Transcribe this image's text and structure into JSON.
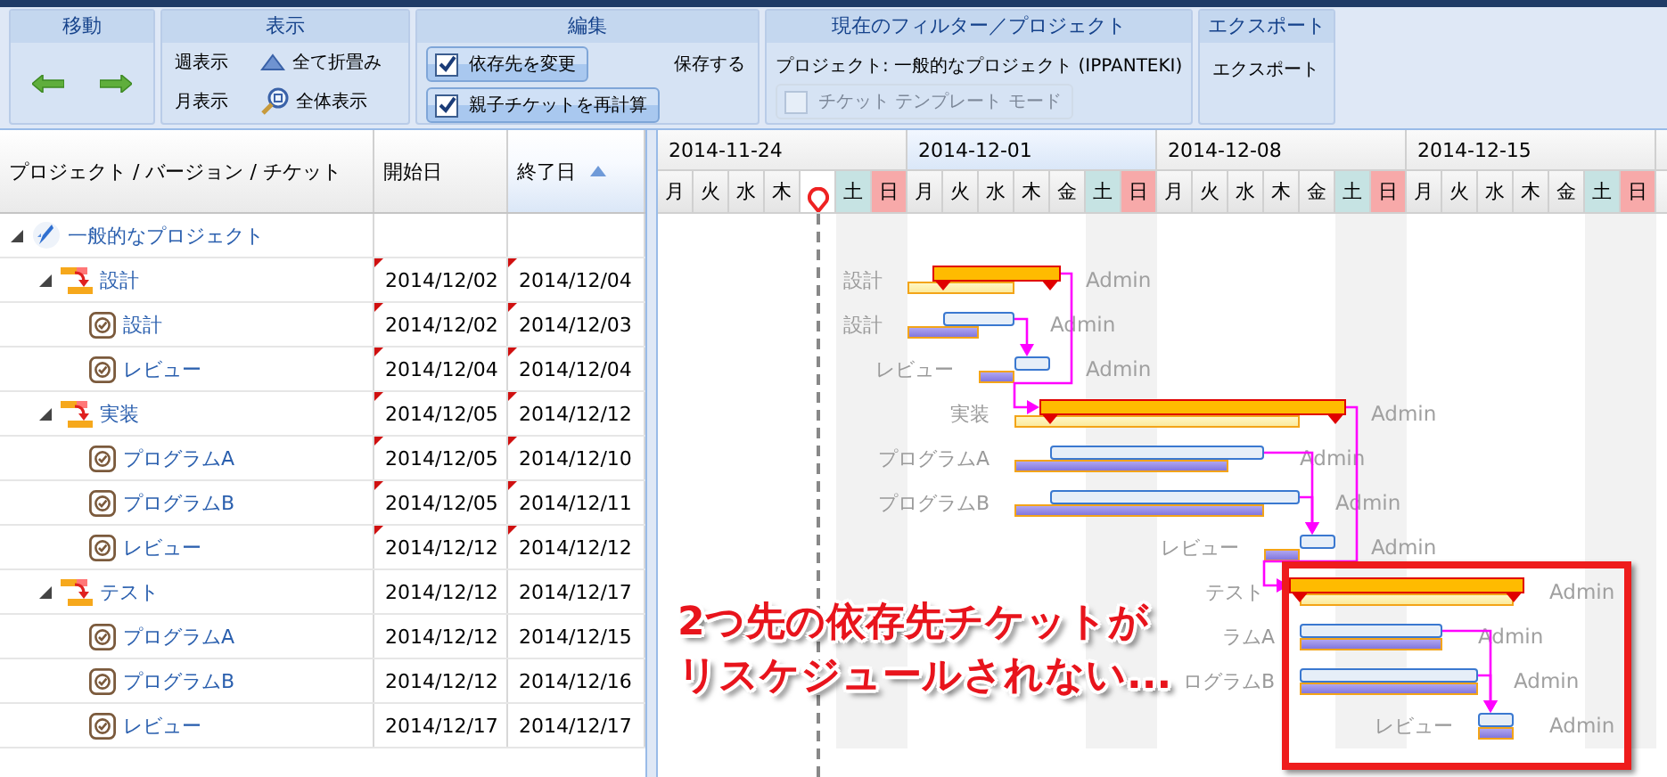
{
  "toolbar": {
    "groups": [
      {
        "kind": "move",
        "title": "移動",
        "items": [
          {
            "kind": "arrow_left"
          },
          {
            "kind": "arrow_right"
          }
        ]
      },
      {
        "kind": "view",
        "title": "表示",
        "items": [
          {
            "kind": "text",
            "label": "週表示"
          },
          {
            "kind": "collapse",
            "label": "全て折畳み"
          },
          {
            "kind": "text",
            "label": "月表示"
          },
          {
            "kind": "zoom",
            "label": "全体表示"
          }
        ]
      },
      {
        "kind": "edit",
        "title": "編集",
        "items": [
          {
            "kind": "check",
            "label": "依存先を変更",
            "checked": true,
            "disabled": false
          },
          {
            "kind": "text",
            "label": "保存する"
          },
          {
            "kind": "check",
            "label": "親子チケットを再計算",
            "checked": true,
            "disabled": false
          }
        ]
      },
      {
        "kind": "filter",
        "title": "現在のフィルター／プロジェクト",
        "items": [
          {
            "kind": "info",
            "label": "プロジェクト:  一般的なプロジェクト (IPPANTEKI)"
          },
          {
            "kind": "check",
            "label": "チケット テンプレート モード",
            "checked": false,
            "disabled": true
          }
        ]
      },
      {
        "kind": "export",
        "title": "エクスポート",
        "items": [
          {
            "kind": "text",
            "label": "エクスポート"
          }
        ]
      }
    ]
  },
  "columns": [
    {
      "label": "プロジェクト / バージョン / チケット",
      "sorted": false
    },
    {
      "label": "開始日",
      "sorted": false
    },
    {
      "label": "終了日",
      "sorted": true
    }
  ],
  "tree": [
    {
      "kind": "project",
      "name": "一般的なプロジェクト",
      "expanded": true,
      "children": [
        {
          "kind": "parent",
          "name": "設計",
          "start": "2014/12/02",
          "end": "2014/12/04",
          "modified": true,
          "rescheduled": true,
          "bar_label": "設計",
          "assignee": "Admin",
          "expanded": true,
          "children": [
            {
              "kind": "ticket",
              "name": "設計",
              "start": "2014/12/02",
              "end": "2014/12/03",
              "modified": true,
              "rescheduled": true,
              "bar_label": "設計",
              "assignee": "Admin"
            },
            {
              "kind": "ticket",
              "name": "レビュー",
              "start": "2014/12/04",
              "end": "2014/12/04",
              "modified": true,
              "rescheduled": true,
              "bar_label": "レビュー",
              "assignee": "Admin"
            }
          ]
        },
        {
          "kind": "parent",
          "name": "実装",
          "start": "2014/12/05",
          "end": "2014/12/12",
          "modified": true,
          "rescheduled": true,
          "bar_label": "実装",
          "assignee": "Admin",
          "expanded": true,
          "children": [
            {
              "kind": "ticket",
              "name": "プログラムA",
              "start": "2014/12/05",
              "end": "2014/12/10",
              "modified": true,
              "rescheduled": true,
              "bar_label": "プログラムA",
              "assignee": "Admin"
            },
            {
              "kind": "ticket",
              "name": "プログラムB",
              "start": "2014/12/05",
              "end": "2014/12/11",
              "modified": true,
              "rescheduled": true,
              "bar_label": "プログラムB",
              "assignee": "Admin"
            },
            {
              "kind": "ticket",
              "name": "レビュー",
              "start": "2014/12/12",
              "end": "2014/12/12",
              "modified": true,
              "rescheduled": true,
              "bar_label": "レビュー",
              "assignee": "Admin"
            }
          ]
        },
        {
          "kind": "parent",
          "name": "テスト",
          "start": "2014/12/12",
          "end": "2014/12/17",
          "modified": false,
          "rescheduled": false,
          "bar_label": "テスト",
          "assignee": "Admin",
          "expanded": true,
          "children": [
            {
              "kind": "ticket",
              "name": "プログラムA",
              "start": "2014/12/12",
              "end": "2014/12/15",
              "modified": false,
              "rescheduled": false,
              "bar_label": "ラムA",
              "assignee": "Admin"
            },
            {
              "kind": "ticket",
              "name": "プログラムB",
              "start": "2014/12/12",
              "end": "2014/12/16",
              "modified": false,
              "rescheduled": false,
              "bar_label": "ログラムB",
              "assignee": "Admin"
            },
            {
              "kind": "ticket",
              "name": "レビュー",
              "start": "2014/12/17",
              "end": "2014/12/17",
              "modified": false,
              "rescheduled": false,
              "bar_label": "レビュー",
              "assignee": "Admin"
            }
          ]
        }
      ]
    }
  ],
  "timeline": {
    "weeks": [
      {
        "label": "2014-11-24",
        "highlighted": false,
        "days": [
          {
            "label": "月",
            "kind": "weekday"
          },
          {
            "label": "火",
            "kind": "weekday"
          },
          {
            "label": "水",
            "kind": "weekday"
          },
          {
            "label": "木",
            "kind": "weekday"
          },
          {
            "kind": "today"
          },
          {
            "label": "土",
            "kind": "saturday"
          },
          {
            "label": "日",
            "kind": "sunday"
          }
        ]
      },
      {
        "label": "2014-12-01",
        "highlighted": true,
        "days": [
          {
            "label": "月",
            "kind": "weekday"
          },
          {
            "label": "火",
            "kind": "weekday"
          },
          {
            "label": "水",
            "kind": "weekday"
          },
          {
            "label": "木",
            "kind": "weekday"
          },
          {
            "label": "金",
            "kind": "weekday"
          },
          {
            "label": "土",
            "kind": "saturday"
          },
          {
            "label": "日",
            "kind": "sunday"
          }
        ]
      },
      {
        "label": "2014-12-08",
        "highlighted": false,
        "days": [
          {
            "label": "月",
            "kind": "weekday"
          },
          {
            "label": "火",
            "kind": "weekday"
          },
          {
            "label": "水",
            "kind": "weekday"
          },
          {
            "label": "木",
            "kind": "weekday"
          },
          {
            "label": "金",
            "kind": "weekday"
          },
          {
            "label": "土",
            "kind": "saturday"
          },
          {
            "label": "日",
            "kind": "sunday"
          }
        ]
      },
      {
        "label": "2014-12-15",
        "highlighted": false,
        "days": [
          {
            "label": "月",
            "kind": "weekday"
          },
          {
            "label": "火",
            "kind": "weekday"
          },
          {
            "label": "水",
            "kind": "weekday"
          },
          {
            "label": "木",
            "kind": "weekday"
          },
          {
            "label": "金",
            "kind": "weekday"
          },
          {
            "label": "土",
            "kind": "saturday"
          },
          {
            "label": "日",
            "kind": "sunday"
          }
        ]
      }
    ]
  },
  "annotation": {
    "lines": [
      "2つ先の依存先チケットが",
      "リスケジュールされない..."
    ]
  }
}
